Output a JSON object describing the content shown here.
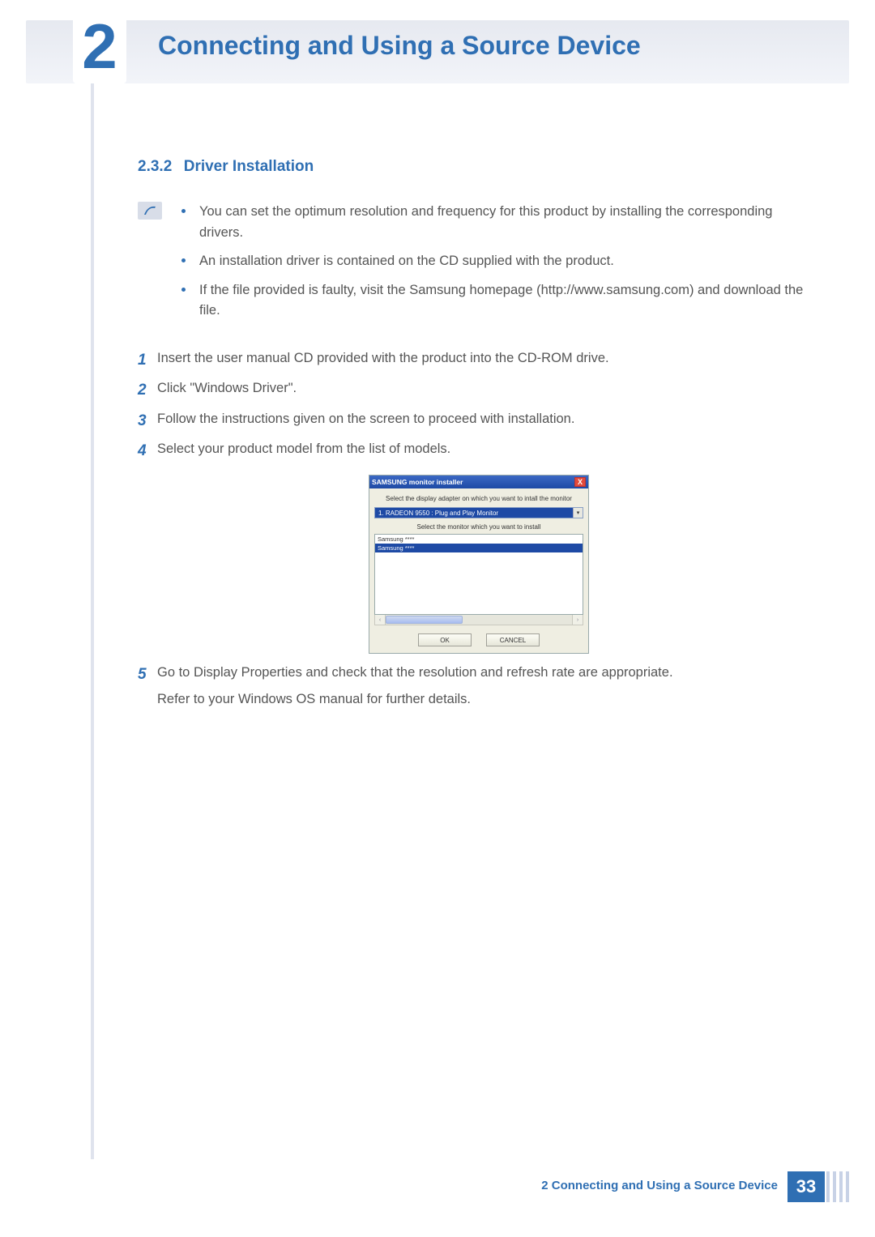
{
  "chapter": {
    "number": "2",
    "title": "Connecting and Using a Source Device"
  },
  "section": {
    "number": "2.3.2",
    "title": "Driver Installation"
  },
  "notes": [
    "You can set the optimum resolution and frequency for this product by installing the corresponding drivers.",
    "An installation driver is contained on the CD supplied with the product.",
    "If the file provided is faulty, visit the Samsung homepage (http://www.samsung.com) and download the file."
  ],
  "steps": {
    "s1": "Insert the user manual CD provided with the product into the CD-ROM drive.",
    "s2": "Click \"Windows Driver\".",
    "s3": "Follow the instructions given on the screen to proceed with installation.",
    "s4": "Select your product model from the list of models.",
    "s5a": "Go to Display Properties and check that the resolution and refresh rate are appropriate.",
    "s5b": "Refer to your Windows OS manual for further details."
  },
  "step_numbers": {
    "n1": "1",
    "n2": "2",
    "n3": "3",
    "n4": "4",
    "n5": "5"
  },
  "dialog": {
    "title": "SAMSUNG monitor installer",
    "close": "X",
    "label_adapter": "Select the display adapter on which you want to intall the monitor",
    "adapter_value": "1. RADEON 9550 : Plug and Play Monitor",
    "dropdown_arrow": "▾",
    "label_monitor": "Select the monitor which you want to install",
    "list_item_a": "Samsung ****",
    "list_item_b": "Samsung ****",
    "scroll_left": "‹",
    "scroll_right": "›",
    "ok": "OK",
    "cancel": "CANCEL"
  },
  "footer": {
    "chapter_ref": "2",
    "title": "Connecting and Using a Source Device",
    "page": "33"
  }
}
